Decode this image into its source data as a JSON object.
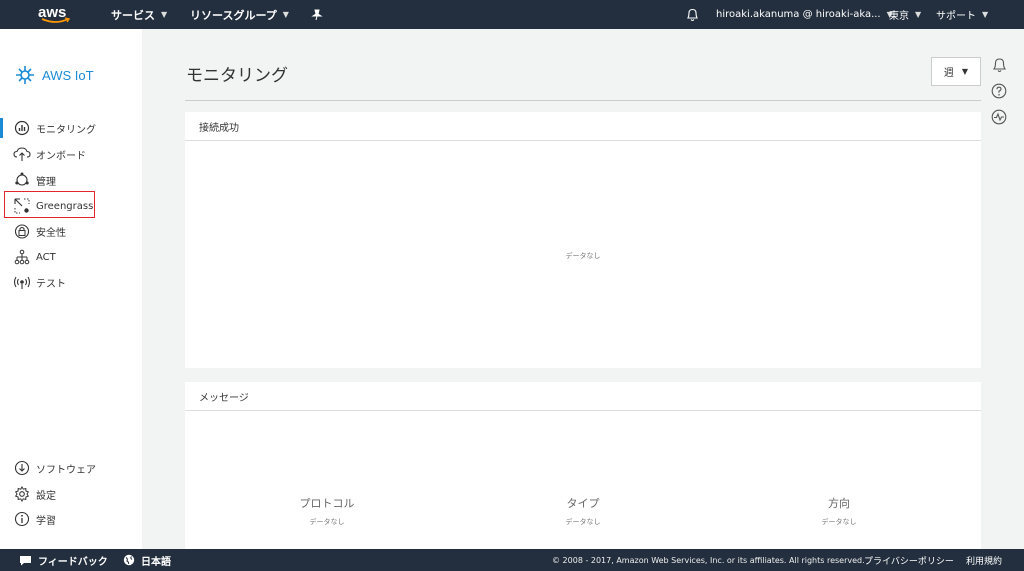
{
  "topnav": {
    "logo": "aws",
    "services": "サービス",
    "resource_groups": "リソースグループ",
    "account": "hiroaki.akanuma @ hiroaki-aka...",
    "region": "東京",
    "support": "サポート"
  },
  "sidebar": {
    "brand": "AWS IoT",
    "items": [
      {
        "label": "モニタリング",
        "icon": "monitoring-icon"
      },
      {
        "label": "オンボード",
        "icon": "cloud-upload-icon"
      },
      {
        "label": "管理",
        "icon": "manage-icon"
      },
      {
        "label": "Greengrass",
        "icon": "greengrass-icon"
      },
      {
        "label": "安全性",
        "icon": "lock-icon"
      },
      {
        "label": "ACT",
        "icon": "act-icon"
      },
      {
        "label": "テスト",
        "icon": "test-icon"
      }
    ],
    "bottom_items": [
      {
        "label": "ソフトウェア",
        "icon": "download-icon"
      },
      {
        "label": "設定",
        "icon": "gear-icon"
      },
      {
        "label": "学習",
        "icon": "info-icon"
      }
    ],
    "accent": "#1b8bd6",
    "highlight_color": "#e0262b"
  },
  "main": {
    "title": "モニタリング",
    "period_select": "週",
    "panel1": {
      "title": "接続成功",
      "nodata": "データなし"
    },
    "panel2": {
      "title": "メッセージ",
      "columns": [
        {
          "header": "プロトコル",
          "value": "データなし"
        },
        {
          "header": "タイプ",
          "value": "データなし"
        },
        {
          "header": "方向",
          "value": "データなし"
        }
      ]
    }
  },
  "footer": {
    "feedback": "フィードバック",
    "language": "日本語",
    "copyright": "© 2008 - 2017, Amazon Web Services, Inc. or its affiliates. All rights reserved.",
    "privacy": "プライバシーポリシー",
    "terms": "利用規約"
  },
  "colors": {
    "nav_bg": "#232f3e",
    "page_bg": "#f2f3f3"
  }
}
